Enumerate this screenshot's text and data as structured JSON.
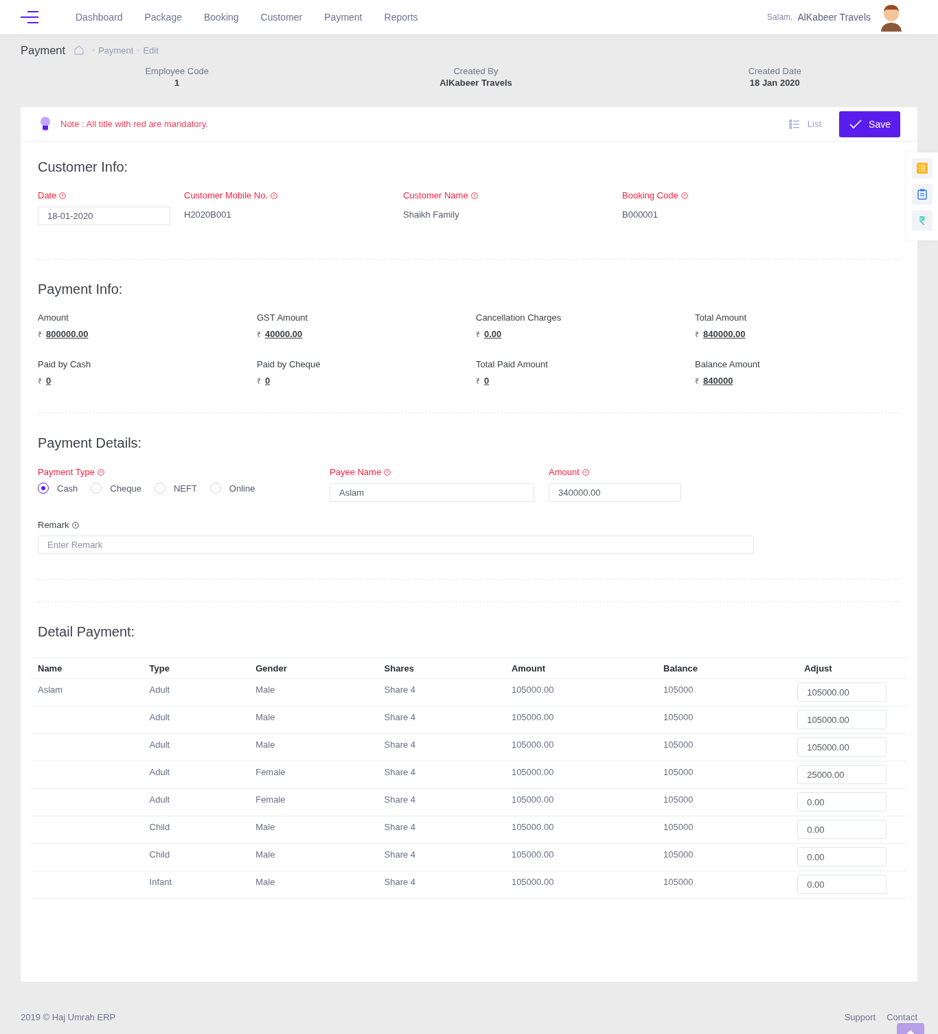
{
  "nav": {
    "items": [
      "Dashboard",
      "Package",
      "Booking",
      "Customer",
      "Payment",
      "Reports"
    ],
    "greeting": "Salam,",
    "user_name": "AlKabeer Travels"
  },
  "breadcrumb": {
    "title": "Payment",
    "items": [
      "Payment",
      "Edit"
    ]
  },
  "meta": [
    {
      "label": "Employee Code",
      "value": "1"
    },
    {
      "label": "Created By",
      "value": "AlKabeer Travels"
    },
    {
      "label": "Created Date",
      "value": "18 Jan 2020"
    }
  ],
  "note": "Note : All title with red are mandatory.",
  "actions": {
    "list": "List",
    "save": "Save"
  },
  "customer_info": {
    "title": "Customer Info:",
    "fields": [
      {
        "label": "Date",
        "required": true,
        "kind": "input",
        "value": "18-01-2020"
      },
      {
        "label": "Customer Mobile No.",
        "required": true,
        "kind": "text",
        "value": "H2020B001"
      },
      {
        "label": "Customer Name",
        "required": true,
        "kind": "text",
        "value": "Shaikh Family"
      },
      {
        "label": "Booking Code",
        "required": true,
        "kind": "text",
        "value": "B000001"
      }
    ]
  },
  "payment_info": {
    "title": "Payment Info:",
    "fields": [
      {
        "label": "Amount",
        "currency": "₹",
        "value": "800000.00"
      },
      {
        "label": "GST Amount",
        "currency": "₹",
        "value": "40000.00"
      },
      {
        "label": "Cancellation Charges",
        "currency": "₹",
        "value": "0.00"
      },
      {
        "label": "Total Amount",
        "currency": "₹",
        "value": "840000.00"
      },
      {
        "label": "Paid by Cash",
        "currency": "₹",
        "value": "0"
      },
      {
        "label": "Paid by Cheque",
        "currency": "₹",
        "value": "0"
      },
      {
        "label": "Total Paid Amount",
        "currency": "₹",
        "value": "0"
      },
      {
        "label": "Balance Amount",
        "currency": "₹",
        "value": "840000"
      }
    ]
  },
  "payment_details": {
    "title": "Payment Details:",
    "payment_type": {
      "label": "Payment Type",
      "required": true,
      "options": [
        {
          "label": "Cash",
          "selected": true
        },
        {
          "label": "Cheque",
          "selected": false
        },
        {
          "label": "NEFT",
          "selected": false
        },
        {
          "label": "Online",
          "selected": false
        }
      ]
    },
    "payee_name": {
      "label": "Payee Name",
      "required": true,
      "value": "Aslam"
    },
    "amount": {
      "label": "Amount",
      "required": true,
      "value": "340000.00"
    },
    "remark": {
      "label": "Remark",
      "required": false,
      "placeholder": "Enter Remark"
    }
  },
  "detail_payment": {
    "title": "Detail Payment:",
    "columns": [
      "Name",
      "Type",
      "Gender",
      "Shares",
      "Amount",
      "Balance",
      "Adjust"
    ],
    "rows": [
      {
        "name": "Aslam",
        "type": "Adult",
        "gender": "Male",
        "shares": "Share 4",
        "amount": "105000.00",
        "balance": "105000",
        "adjust": "105000.00"
      },
      {
        "type": "Adult",
        "gender": "Male",
        "shares": "Share 4",
        "amount": "105000.00",
        "balance": "105000",
        "adjust": "105000.00"
      },
      {
        "type": "Adult",
        "gender": "Male",
        "shares": "Share 4",
        "amount": "105000.00",
        "balance": "105000",
        "adjust": "105000.00"
      },
      {
        "type": "Adult",
        "gender": "Female",
        "shares": "Share 4",
        "amount": "105000.00",
        "balance": "105000",
        "adjust": "25000.00"
      },
      {
        "type": "Adult",
        "gender": "Female",
        "shares": "Share 4",
        "amount": "105000.00",
        "balance": "105000",
        "adjust": "0.00"
      },
      {
        "type": "Child",
        "gender": "Male",
        "shares": "Share 4",
        "amount": "105000.00",
        "balance": "105000",
        "adjust": "0.00"
      },
      {
        "type": "Child",
        "gender": "Male",
        "shares": "Share 4",
        "amount": "105000.00",
        "balance": "105000",
        "adjust": "0.00"
      },
      {
        "type": "Infant",
        "gender": "Male",
        "shares": "Share 4",
        "amount": "105000.00",
        "balance": "105000",
        "adjust": "0.00"
      }
    ]
  },
  "footer": {
    "copyright": "2019 © Haj Umrah ERP",
    "links": [
      "Support",
      "Contact"
    ]
  }
}
